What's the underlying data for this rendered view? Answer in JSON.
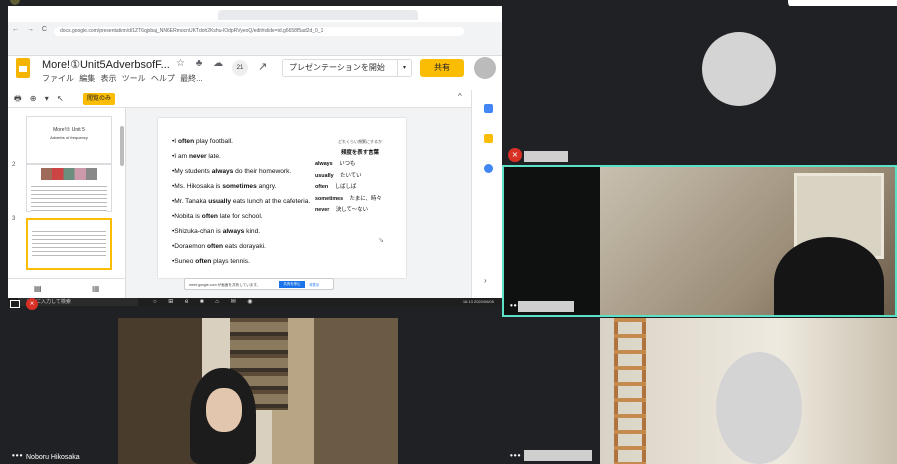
{
  "browser": {
    "url": "docs.google.com/presentation/d/1ZT6qjxbaj_NN6ERmocnUKTdoh2Kshu-lOdpRVyeoQ/edit#slide=id.g6658f5ad2d_0_1",
    "nav_icons": "← → C"
  },
  "doc": {
    "title": "More!①Unit5AdverbsofF...",
    "menu": "ファイル  編集  表示  ツール  ヘルプ  最終...",
    "title_icons": "☆ ♣ ☁",
    "comments_count": "21",
    "present_label": "プレゼンテーションを開始",
    "share_label": "共有",
    "view_only_label": "閲覧のみ"
  },
  "toolbar": {
    "tools": "🖶 ⊕ ▾ ↖"
  },
  "filmstrip": {
    "items": [
      {
        "num": "",
        "title": "More!① Unit 5",
        "subtitle": "Adverbs of frequency"
      },
      {
        "num": "2"
      },
      {
        "num": "3"
      }
    ]
  },
  "slide": {
    "bullets": [
      {
        "pre": "•I ",
        "bold": "often",
        "post": " play football."
      },
      {
        "pre": "•I am ",
        "bold": "never",
        "post": " late."
      },
      {
        "pre": "•My students ",
        "bold": "always",
        "post": " do their homework."
      },
      {
        "pre": "•Ms. Hikosaka is ",
        "bold": "sometimes",
        "post": " angry."
      },
      {
        "pre": "•Mr. Tanaka ",
        "bold": "usually",
        "post": " eats lunch at the cafeteria."
      },
      {
        "pre": "•Nobita is ",
        "bold": "often",
        "post": " late for school."
      },
      {
        "pre": "•Shizuka-chan is ",
        "bold": "always",
        "post": " kind."
      },
      {
        "pre": "•Doraemon ",
        "bold": "often",
        "post": " eats dorayaki."
      },
      {
        "pre": "•Suneo ",
        "bold": "often",
        "post": " plays tennis."
      }
    ],
    "freq_sub": "どれくらい頻繁にするか",
    "freq_heading": "頻度を表す言葉",
    "freq_rows": [
      {
        "en": "always",
        "ja": "いつも"
      },
      {
        "en": "usually",
        "ja": "たいてい"
      },
      {
        "en": "often",
        "ja": "しばしば"
      },
      {
        "en": "sometimes",
        "ja": "たまに、時々"
      },
      {
        "en": "never",
        "ja": "決して～ない"
      }
    ]
  },
  "notification": {
    "text": "meet.google.com が画面を共有しています。",
    "stop_label": "共有を停止",
    "hide_label": "非表示"
  },
  "taskbar": {
    "search_placeholder": "ここに入力して検索",
    "tray_time": "16:13",
    "tray_date": "2020/06/05"
  },
  "participants": {
    "presenter_name": "Noboru Hikosaka",
    "more_dots": "•••"
  },
  "colors": {
    "meet_accent": "#5ce1c6",
    "mic_off": "#d93025",
    "slides_yellow": "#fbbc04"
  }
}
